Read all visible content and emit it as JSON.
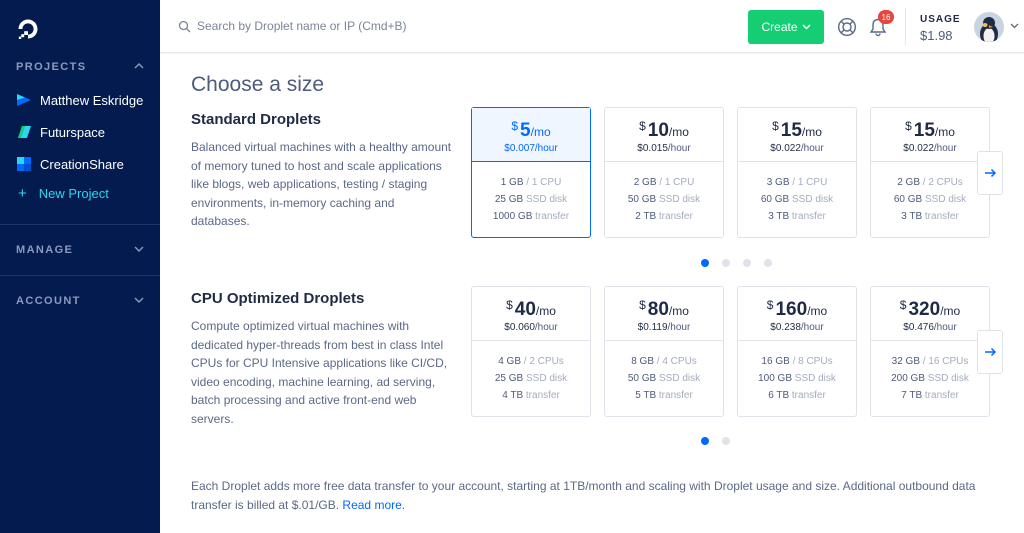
{
  "sidebar": {
    "logo_icon": "digitalocean-logo-icon",
    "projects_title": "PROJECTS",
    "projects": [
      {
        "label": "Matthew Eskridge",
        "color": "#0069ff"
      },
      {
        "label": "Futurspace",
        "color": "#29d7f0"
      },
      {
        "label": "CreationShare",
        "color": "#0069ff"
      }
    ],
    "new_project": "New Project",
    "manage_title": "MANAGE",
    "account_title": "ACCOUNT"
  },
  "header": {
    "search_placeholder": "Search by Droplet name or IP (Cmd+B)",
    "create_label": "Create",
    "notification_count": "16",
    "usage_label": "USAGE",
    "usage_value": "$1.98"
  },
  "main": {
    "title": "Choose a size",
    "standard": {
      "title": "Standard Droplets",
      "description": "Balanced virtual machines with a healthy amount of memory tuned to host and scale applications like blogs, web applications, testing / staging environments, in-memory caching and databases.",
      "plans": [
        {
          "currency": "$",
          "amount": "5",
          "per": "/mo",
          "hourly": "$0.007",
          "hour_unit": "/hour",
          "ram": "1 GB",
          "cpu": "/ 1 CPU",
          "disk": "25 GB",
          "disk_unit": "SSD disk",
          "transfer": "1000 GB",
          "transfer_unit": "transfer",
          "selected": true
        },
        {
          "currency": "$",
          "amount": "10",
          "per": "/mo",
          "hourly": "$0.015",
          "hour_unit": "/hour",
          "ram": "2 GB",
          "cpu": "/ 1 CPU",
          "disk": "50 GB",
          "disk_unit": "SSD disk",
          "transfer": "2 TB",
          "transfer_unit": "transfer",
          "selected": false
        },
        {
          "currency": "$",
          "amount": "15",
          "per": "/mo",
          "hourly": "$0.022",
          "hour_unit": "/hour",
          "ram": "3 GB",
          "cpu": "/ 1 CPU",
          "disk": "60 GB",
          "disk_unit": "SSD disk",
          "transfer": "3 TB",
          "transfer_unit": "transfer",
          "selected": false
        },
        {
          "currency": "$",
          "amount": "15",
          "per": "/mo",
          "hourly": "$0.022",
          "hour_unit": "/hour",
          "ram": "2 GB",
          "cpu": "/ 2 CPUs",
          "disk": "60 GB",
          "disk_unit": "SSD disk",
          "transfer": "3 TB",
          "transfer_unit": "transfer",
          "selected": false
        }
      ],
      "pages": 4,
      "active_page": 1
    },
    "cpu": {
      "title": "CPU Optimized Droplets",
      "description": "Compute optimized virtual machines with dedicated hyper-threads from best in class Intel CPUs for CPU Intensive applications like CI/CD, video encoding, machine learning, ad serving, batch processing and active front-end web servers.",
      "plans": [
        {
          "currency": "$",
          "amount": "40",
          "per": "/mo",
          "hourly": "$0.060",
          "hour_unit": "/hour",
          "ram": "4 GB",
          "cpu": "/ 2 CPUs",
          "disk": "25 GB",
          "disk_unit": "SSD disk",
          "transfer": "4 TB",
          "transfer_unit": "transfer",
          "selected": false
        },
        {
          "currency": "$",
          "amount": "80",
          "per": "/mo",
          "hourly": "$0.119",
          "hour_unit": "/hour",
          "ram": "8 GB",
          "cpu": "/ 4 CPUs",
          "disk": "50 GB",
          "disk_unit": "SSD disk",
          "transfer": "5 TB",
          "transfer_unit": "transfer",
          "selected": false
        },
        {
          "currency": "$",
          "amount": "160",
          "per": "/mo",
          "hourly": "$0.238",
          "hour_unit": "/hour",
          "ram": "16 GB",
          "cpu": "/ 8 CPUs",
          "disk": "100 GB",
          "disk_unit": "SSD disk",
          "transfer": "6 TB",
          "transfer_unit": "transfer",
          "selected": false
        },
        {
          "currency": "$",
          "amount": "320",
          "per": "/mo",
          "hourly": "$0.476",
          "hour_unit": "/hour",
          "ram": "32 GB",
          "cpu": "/ 16 CPUs",
          "disk": "200 GB",
          "disk_unit": "SSD disk",
          "transfer": "7 TB",
          "transfer_unit": "transfer",
          "selected": false
        }
      ],
      "pages": 2,
      "active_page": 1
    },
    "footer_text": "Each Droplet adds more free data transfer to your account, starting at 1TB/month and scaling with Droplet usage and size. Additional outbound data transfer is billed at $.01/GB.",
    "footer_link": "Read more."
  },
  "colors": {
    "accent": "#0069ff",
    "create": "#15cd72",
    "sidebar": "#031b4e",
    "badge": "#e5463d"
  }
}
